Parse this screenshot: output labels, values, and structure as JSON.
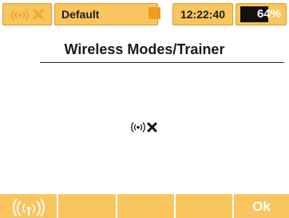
{
  "statusbar": {
    "signal_icon": "signal-icon",
    "no_signal_icon": "x-icon",
    "model_name": "Default",
    "time": "12:22:40",
    "battery_percent": "64%",
    "battery_level": 0.64
  },
  "page": {
    "title": "Wireless Modes/Trainer"
  },
  "center": {
    "signal_icon": "signal-icon",
    "status_icon": "x-icon"
  },
  "function_keys": {
    "f1_icon": "wireless-trainer-icon",
    "f2_label": "",
    "f3_label": "",
    "f4_label": "",
    "f5_label": "Ok"
  },
  "colors": {
    "accent": "#f8c55f",
    "accent_border": "#d99d2b",
    "indicator": "#f29b1e",
    "icon_orange": "#f5a623",
    "text": "#1a1a1a"
  }
}
